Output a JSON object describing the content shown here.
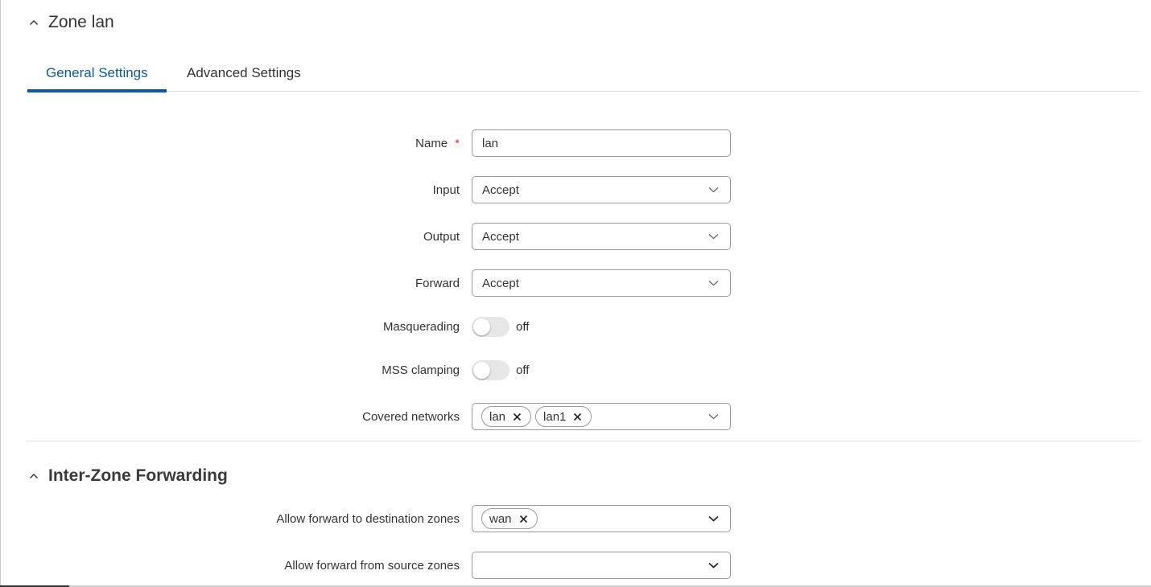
{
  "zone_section": {
    "title": "Zone lan",
    "tabs": [
      {
        "label": "General Settings",
        "active": true
      },
      {
        "label": "Advanced Settings",
        "active": false
      }
    ],
    "fields": {
      "name": {
        "label": "Name",
        "required_mark": "*",
        "value": "lan"
      },
      "input": {
        "label": "Input",
        "value": "Accept"
      },
      "output": {
        "label": "Output",
        "value": "Accept"
      },
      "forward": {
        "label": "Forward",
        "value": "Accept"
      },
      "masquerading": {
        "label": "Masquerading",
        "state": "off"
      },
      "mss_clamping": {
        "label": "MSS clamping",
        "state": "off"
      },
      "covered_networks": {
        "label": "Covered networks",
        "chips": [
          "lan",
          "lan1"
        ]
      }
    }
  },
  "forwarding_section": {
    "title": "Inter-Zone Forwarding",
    "fields": {
      "dest_zones": {
        "label": "Allow forward to destination zones",
        "chips": [
          "wan"
        ]
      },
      "source_zones": {
        "label": "Allow forward from source zones",
        "chips": []
      }
    }
  },
  "colors": {
    "accent": "#0a5aa5",
    "required": "#d9342b",
    "border": "#9a9a9a"
  },
  "icons": {
    "collapse": "chevron-up-icon",
    "dropdown": "chevron-down-icon",
    "remove": "close-icon"
  }
}
